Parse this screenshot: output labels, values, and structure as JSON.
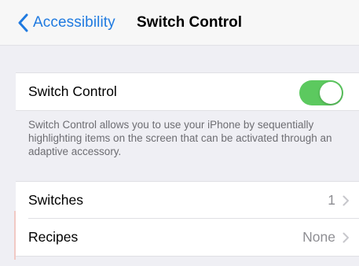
{
  "navbar": {
    "back_label": "Accessibility",
    "title": "Switch Control"
  },
  "switch_control": {
    "label": "Switch Control",
    "enabled": true,
    "toggle_color": "#5cc95f",
    "footer": "Switch Control allows you to use your iPhone by sequentially highlighting items on the screen that can be activated through an adaptive accessory."
  },
  "rows": {
    "switches": {
      "label": "Switches",
      "value": "1"
    },
    "recipes": {
      "label": "Recipes",
      "value": "None"
    }
  },
  "colors": {
    "accent": "#1f7ae0",
    "background": "#efeff4",
    "secondary_text": "#8e8e93"
  },
  "icons": {
    "back": "chevron-left-icon",
    "disclosure": "chevron-right-icon"
  }
}
